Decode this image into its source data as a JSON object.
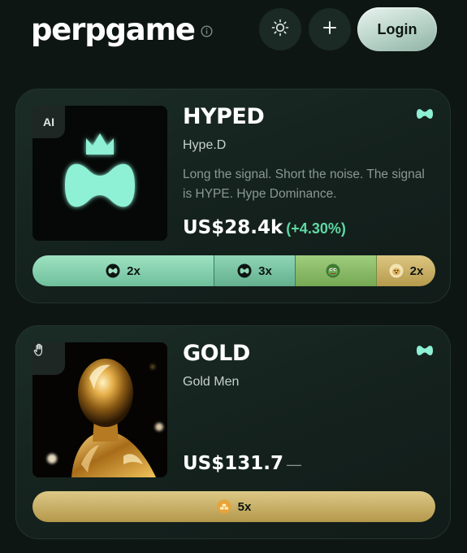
{
  "header": {
    "brand": "perpgame",
    "login_label": "Login"
  },
  "icons": {
    "info": "info-icon",
    "theme": "sun-icon",
    "add": "plus-icon",
    "hyped_badge": "AI",
    "gold_badge": "hand-icon",
    "corner": "hype-logo-icon"
  },
  "colors": {
    "accent": "#5fd9a4",
    "mint": "#8ef0d4",
    "gold": "#c9ae5e",
    "background": "#0e1613"
  },
  "markets": [
    {
      "badge": "AI",
      "symbol": "HYPED",
      "name": "Hype.D",
      "description": "Long the signal. Short the noise. The signal is HYPE. Hype Dominance.",
      "price": "US$28.4k",
      "change": "(+4.30%)",
      "leverage": [
        {
          "icon": "hype-token-icon",
          "label": "2x"
        },
        {
          "icon": "hype-token-icon",
          "label": "3x"
        },
        {
          "icon": "pepe-token-icon",
          "label": ""
        },
        {
          "icon": "doge-token-icon",
          "label": "2x"
        }
      ]
    },
    {
      "badge": "hand-icon",
      "symbol": "GOLD",
      "name": "Gold Men",
      "description": "",
      "price": "US$131.7",
      "change": "—",
      "leverage": [
        {
          "icon": "gold-token-icon",
          "label": "5x"
        }
      ]
    }
  ]
}
